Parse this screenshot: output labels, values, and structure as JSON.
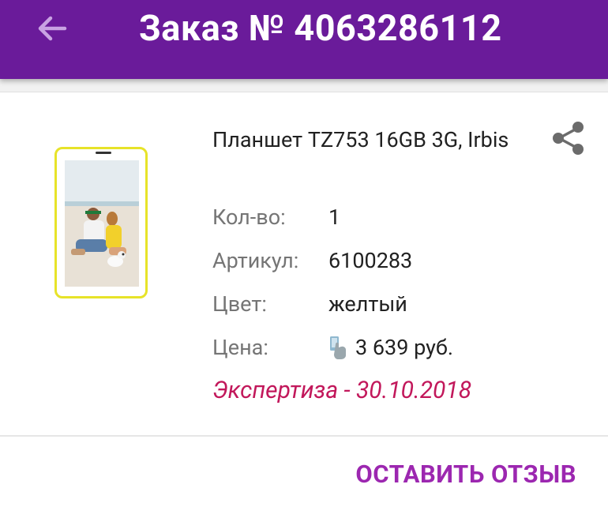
{
  "appbar": {
    "title": "Заказ № 4063286112",
    "back_icon": "arrow-left-icon",
    "color": "#6a1b9a"
  },
  "product": {
    "name": "Планшет TZ753 16GB 3G, Irbis",
    "image_icon": "tablet-image",
    "share_icon": "share-icon",
    "details": [
      {
        "label": "Кол-во:",
        "value": "1"
      },
      {
        "label": "Артикул:",
        "value": "6100283"
      },
      {
        "label": "Цвет:",
        "value": "желтый"
      },
      {
        "label": "Цена:",
        "value": "3 639 руб.",
        "icon": "card-payment-icon"
      }
    ],
    "expertise": "Экспертиза - 30.10.2018",
    "expertise_color": "#c2185b"
  },
  "actions": {
    "review_label": "ОСТАВИТЬ ОТЗЫВ",
    "accent": "#9c27b0"
  }
}
